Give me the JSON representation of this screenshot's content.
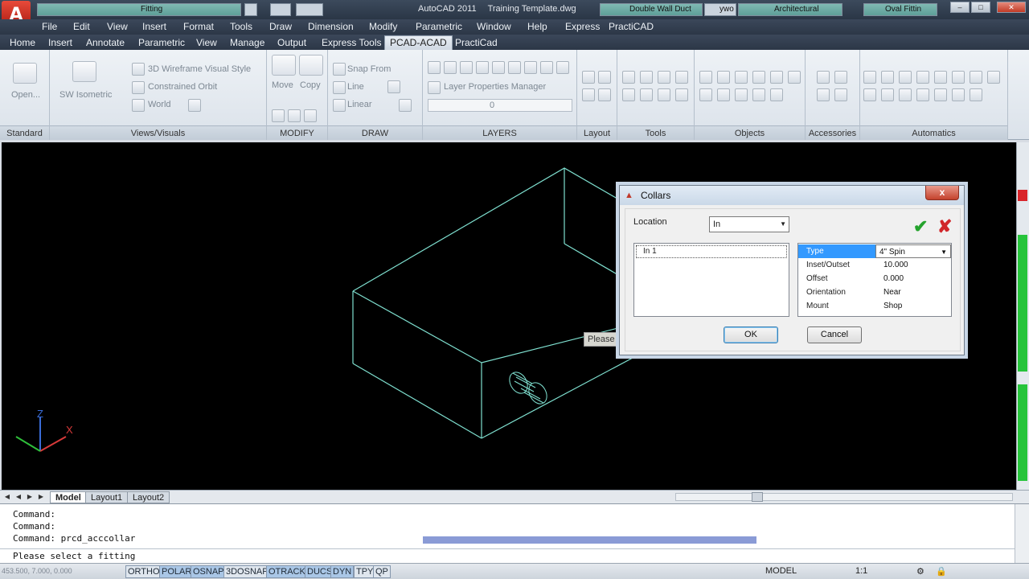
{
  "titlebar": {
    "app_logo": "A",
    "qa_field_1": "Fitting",
    "title": "AutoCAD 2011",
    "document": "Training Template.dwg",
    "qa_field_2": "Double Wall Duct",
    "qa_field_3": "Architectural",
    "qa_field_4": "Oval Fittin",
    "qa_field_5": "ywo"
  },
  "menu": [
    "File",
    "Edit",
    "View",
    "Insert",
    "Format",
    "Tools",
    "Draw",
    "Dimension",
    "Modify",
    "Parametric",
    "Window",
    "Help",
    "Express",
    "PractiCAD"
  ],
  "tabs": [
    "Home",
    "Insert",
    "Annotate",
    "Parametric",
    "View",
    "Manage",
    "Output",
    "Express Tools",
    "PCAD-ACAD",
    "PractiCad"
  ],
  "active_tab": "PCAD-ACAD",
  "ribbon": {
    "panels": [
      "Standard",
      "Views/Visuals",
      "MODIFY",
      "DRAW",
      "LAYERS",
      "Layout",
      "Tools",
      "Objects",
      "Accessories",
      "Automatics"
    ],
    "open_label": "Open...",
    "sw_isometric": "SW Isometric",
    "visual_style": "3D Wireframe Visual Style",
    "constrained_orbit": "Constrained Orbit",
    "world": "World",
    "move": "Move",
    "copy": "Copy",
    "snap_from": "Snap From",
    "line": "Line",
    "linear": "Linear",
    "layer_properties": "Layer Properties Manager",
    "layer_value": "0"
  },
  "canvas": {
    "tooltip": "Please s"
  },
  "layout_tabs": [
    "Model",
    "Layout1",
    "Layout2"
  ],
  "command": {
    "lines": [
      "Command:",
      "Command:",
      "Command: prcd_acccollar"
    ],
    "prompt": "Please select a fitting"
  },
  "status": {
    "coords": "453.500, 7.000, 0.000",
    "toggles": [
      "ORTHO",
      "POLAR",
      "OSNAP",
      "3DOSNAP",
      "OTRACK",
      "DUCS",
      "DYN",
      "TPY",
      "QP"
    ],
    "on_toggles": [
      "POLAR",
      "OSNAP",
      "OTRACK",
      "DUCS",
      "DYN"
    ],
    "model": "MODEL",
    "scale": "1:1"
  },
  "dialog": {
    "title": "Collars",
    "close": "x",
    "location_label": "Location",
    "location_value": "In",
    "list_items": [
      "In 1"
    ],
    "properties": [
      {
        "name": "Type",
        "value": "4\" Spin"
      },
      {
        "name": "Inset/Outset",
        "value": "10.000"
      },
      {
        "name": "Offset",
        "value": "0.000"
      },
      {
        "name": "Orientation",
        "value": "Near"
      },
      {
        "name": "Mount",
        "value": "Shop"
      }
    ],
    "ok": "OK",
    "cancel": "Cancel"
  },
  "colors": {
    "wireframe": "#7fe0d0",
    "canvas_bg": "#000000",
    "accent_selected": "#3399ff"
  }
}
